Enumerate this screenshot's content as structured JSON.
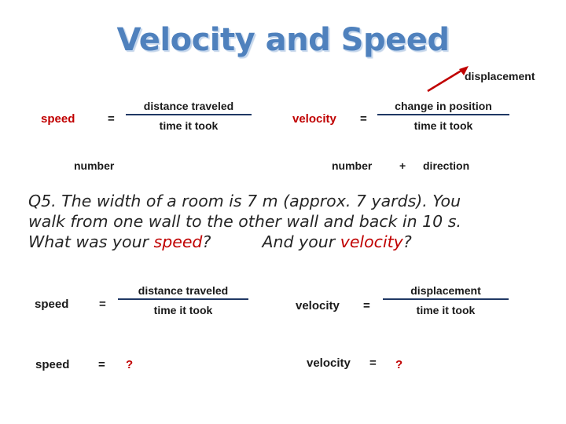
{
  "title": "Velocity and Speed",
  "colors": {
    "title": "#4f81bd",
    "title_shadow": "#c6d9f0",
    "accent_red": "#c00000",
    "rule": "#1f3864",
    "arrow": "#c00000",
    "body_text": "#262626"
  },
  "top_row": {
    "speed_label": "speed",
    "equals": "=",
    "speed_numerator": "distance traveled",
    "speed_denominator": "time it took",
    "velocity_label": "velocity",
    "velocity_equals": "=",
    "velocity_numerator": "change in position",
    "velocity_denominator": "time it took",
    "callout": "displacement"
  },
  "descriptor_row": {
    "left_number": "number",
    "right_number": "number",
    "plus": "+",
    "direction": "direction"
  },
  "question": {
    "line1": "Q5. The width of a room is 7 m (approx. 7 yards). You",
    "line2": "walk from one wall to the other wall and back in 10 s.",
    "line3_a": "What was your ",
    "line3_em1": "speed",
    "line3_b": "?",
    "line3_gap": "          ",
    "line3_c": "And your ",
    "line3_em2": "velocity",
    "line3_d": "?"
  },
  "work_row_1": {
    "speed_label": "speed",
    "equals": "=",
    "speed_numerator": "distance traveled",
    "speed_denominator": "time it took",
    "velocity_label": "velocity",
    "velocity_equals": "=",
    "velocity_numerator": "displacement",
    "velocity_denominator": "time it took"
  },
  "work_row_2": {
    "speed_label": "speed",
    "equals": "=",
    "speed_answer": "?",
    "velocity_label": "velocity",
    "velocity_equals": "=",
    "velocity_answer": "?"
  }
}
